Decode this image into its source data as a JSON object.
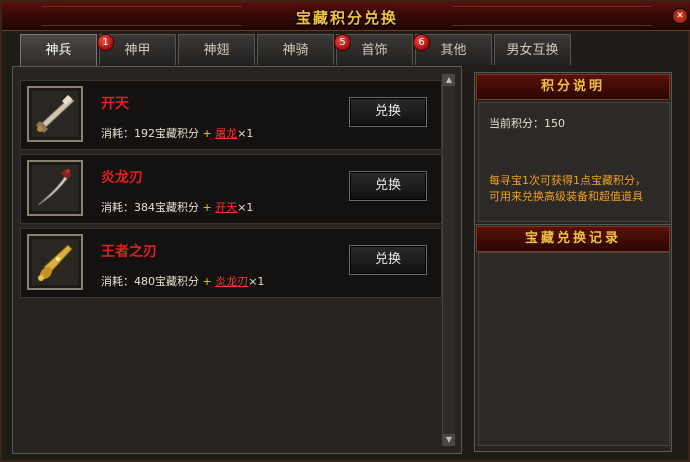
{
  "window": {
    "title": "宝藏积分兑换",
    "close_icon": "close-icon"
  },
  "tabs": [
    {
      "label": "神兵",
      "badge": "",
      "active": true
    },
    {
      "label": "神甲",
      "badge": "1",
      "active": false
    },
    {
      "label": "神翅",
      "badge": "",
      "active": false
    },
    {
      "label": "神骑",
      "badge": "",
      "active": false
    },
    {
      "label": "首饰",
      "badge": "5",
      "active": false
    },
    {
      "label": "其他",
      "badge": "6",
      "active": false
    },
    {
      "label": "男女互换",
      "badge": "",
      "active": false
    }
  ],
  "items": [
    {
      "name": "开天",
      "icon": "sword-kaitian-icon",
      "cost_prefix": "消耗：",
      "points": "192",
      "points_unit": "宝藏积分",
      "plus": "+",
      "requires": "屠龙",
      "times": "×1",
      "button": "兑换"
    },
    {
      "name": "炎龙刃",
      "icon": "blade-yanlong-icon",
      "cost_prefix": "消耗：",
      "points": "384",
      "points_unit": "宝藏积分",
      "plus": "+",
      "requires": "开天",
      "times": "×1",
      "button": "兑换"
    },
    {
      "name": "王者之刃",
      "icon": "blade-wangzhe-icon",
      "cost_prefix": "消耗：",
      "points": "480",
      "points_unit": "宝藏积分",
      "plus": "+",
      "requires": "炎龙刃",
      "times": "×1",
      "button": "兑换"
    }
  ],
  "points_panel": {
    "header": "积分说明",
    "current_label": "当前积分：",
    "current_value": "150",
    "description_line1": "每寻宝1次可获得1点宝藏积分，",
    "description_line2": "可用来兑换高级装备和超值道具"
  },
  "record_panel": {
    "header": "宝藏兑换记录"
  },
  "scrollbar": {
    "up_icon": "scroll-up-icon",
    "down_icon": "scroll-down-icon"
  },
  "colors": {
    "title_gold": "#f0c040",
    "item_name_red": "#e02020",
    "desc_orange": "#f0a020",
    "badge_red": "#c01818"
  }
}
